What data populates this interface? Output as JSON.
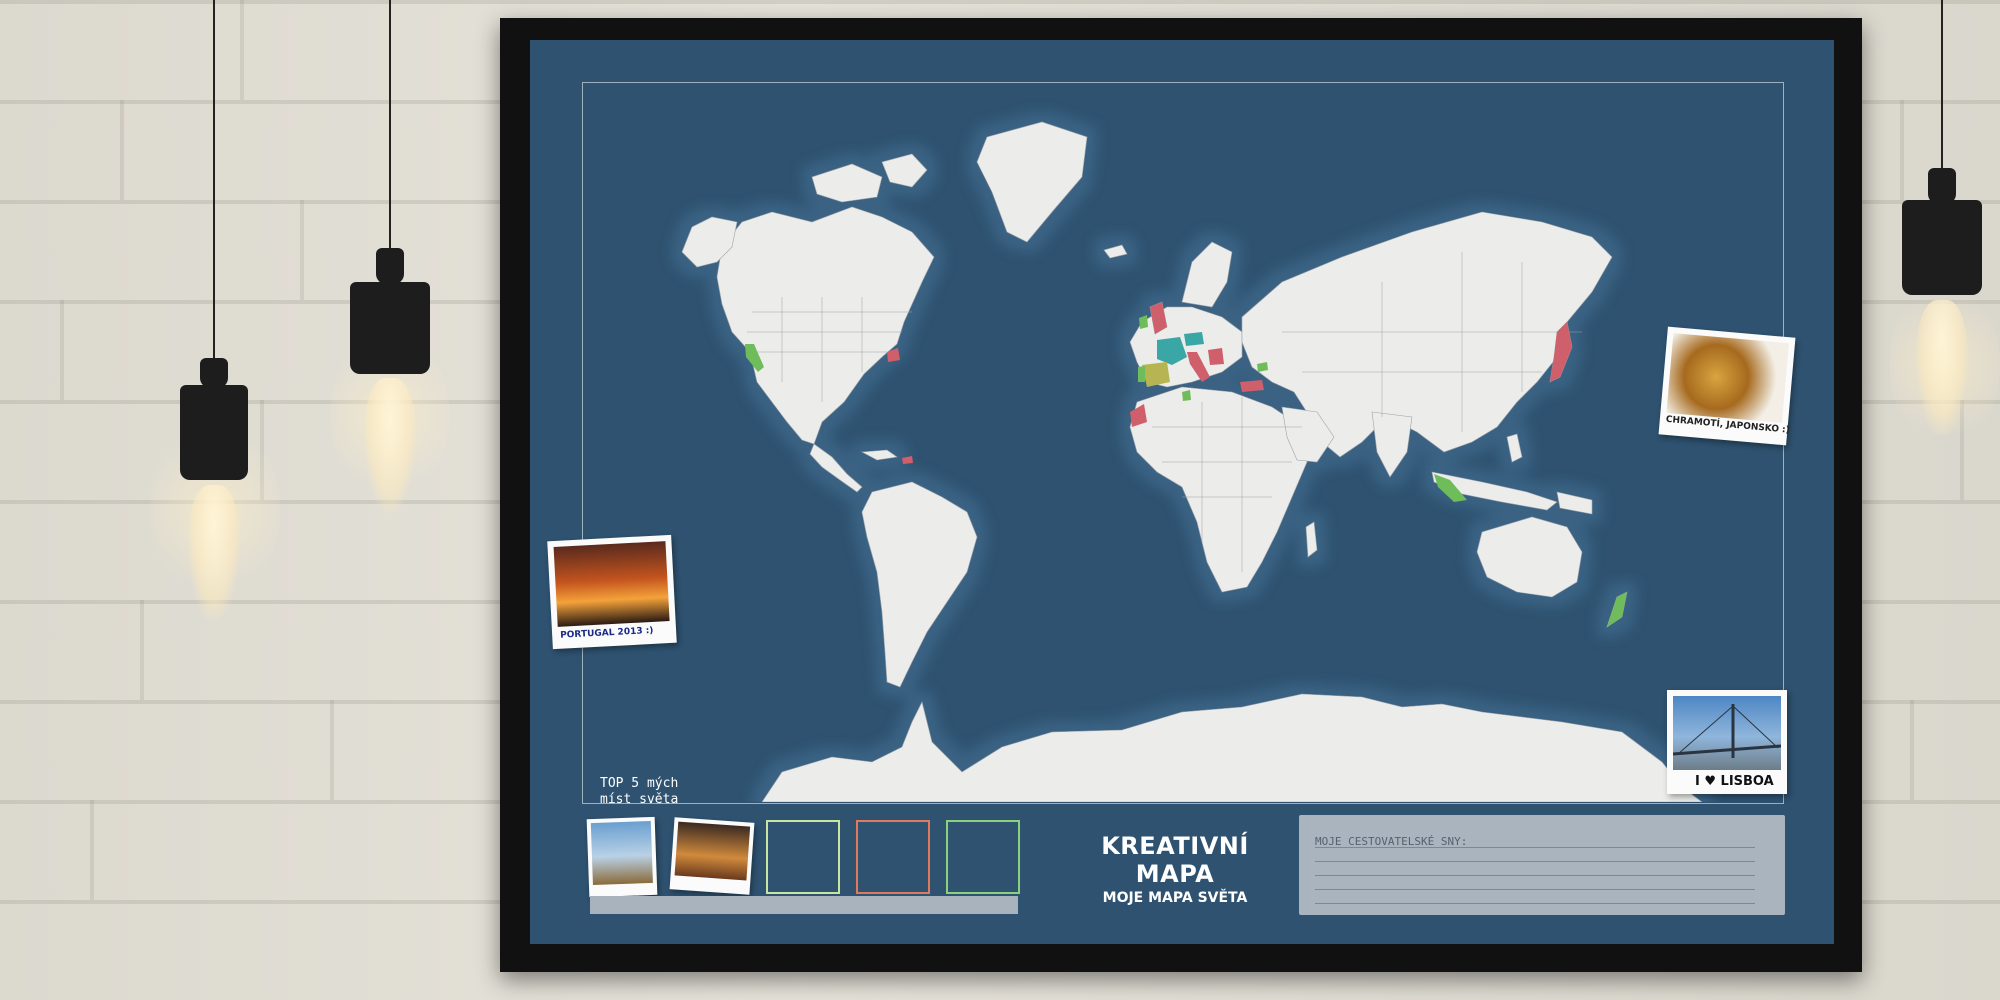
{
  "scene": {
    "colors": {
      "wall": "#dcd9cf",
      "frame": "#111111",
      "poster": "#2e5270",
      "land": "#ececea",
      "visited_red": "#cf5f6b",
      "visited_green": "#6ebd5a",
      "visited_teal": "#3aa6a6",
      "visited_yellow": "#b7b552"
    },
    "lamps": [
      "pendant-lamp-1",
      "pendant-lamp-2",
      "pendant-lamp-3"
    ]
  },
  "poster": {
    "top5_label": "TOP 5 mých\nmíst světa",
    "slot_colors": [
      "#c8e6a0",
      "#e07a5f",
      "#8bd17c"
    ],
    "title": "KREATIVNÍ MAPA",
    "subtitle": "MOJE MAPA SVĚTA",
    "notes_label": "MOJE CESTOVATELSKÉ SNY:"
  },
  "polaroids": {
    "left": {
      "caption": "PORTUGAL 2013 :)"
    },
    "top_right": {
      "caption": "CHRAMOTÍ, JAPONSKO :)"
    },
    "bottom_right": {
      "caption": "I ♥ LISBOA"
    }
  }
}
